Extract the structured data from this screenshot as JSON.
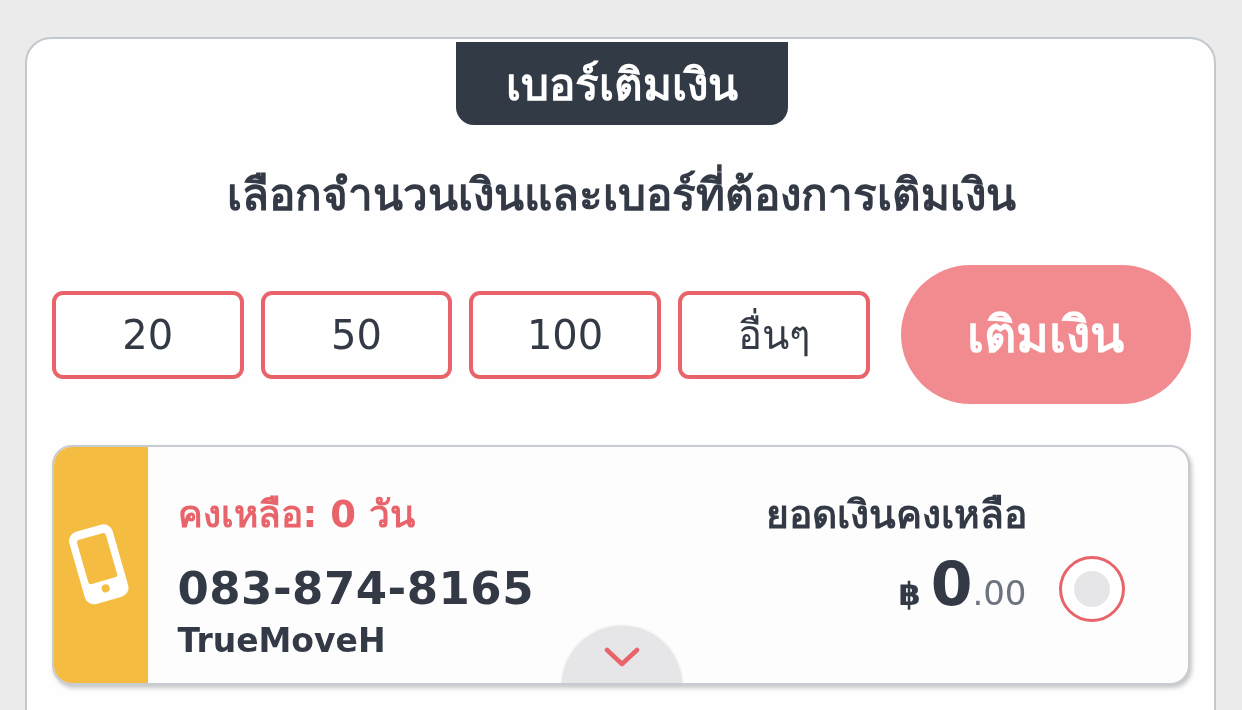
{
  "title_tab": "เบอร์เติมเงิน",
  "instruction": "เลือกจำนวนเงินและเบอร์ที่ต้องการเติมเงิน",
  "amounts": [
    {
      "label": "20",
      "selected": false
    },
    {
      "label": "50",
      "selected": false
    },
    {
      "label": "100",
      "selected": false
    },
    {
      "label": "อื่นๆ",
      "selected": false
    }
  ],
  "top_up_button": {
    "label": "เติมเงิน",
    "disabled": true
  },
  "account": {
    "days_left": "คงเหลือ: 0 วัน",
    "phone_number": "083-874-8165",
    "carrier": "TrueMoveH",
    "balance_label": "ยอดเงินคงเหลือ",
    "currency": "฿",
    "balance_whole": "0",
    "balance_decimal": ".00",
    "selected": false
  }
}
